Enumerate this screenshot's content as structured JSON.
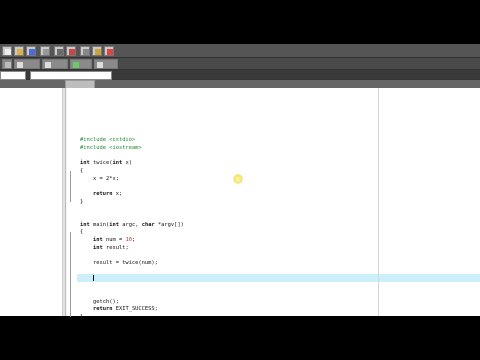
{
  "editor": {
    "lines": [
      {
        "id": "l1",
        "parts": [
          [
            "pp",
            "#include <cstdio>"
          ]
        ]
      },
      {
        "id": "l2",
        "parts": [
          [
            "pp",
            "#include <iostream>"
          ]
        ]
      },
      {
        "id": "l3",
        "parts": []
      },
      {
        "id": "l4",
        "parts": [
          [
            "kw",
            "int"
          ],
          [
            "",
            " twice("
          ],
          [
            "kw",
            "int"
          ],
          [
            "",
            " x)"
          ]
        ]
      },
      {
        "id": "l5",
        "parts": [
          [
            "",
            "{"
          ]
        ]
      },
      {
        "id": "l6",
        "parts": [
          [
            "",
            "    x = 2*x;"
          ]
        ]
      },
      {
        "id": "l7",
        "parts": []
      },
      {
        "id": "l8",
        "parts": [
          [
            "",
            "    "
          ],
          [
            "kw",
            "return"
          ],
          [
            "",
            " x;"
          ]
        ]
      },
      {
        "id": "l9",
        "parts": [
          [
            "",
            "}"
          ]
        ]
      },
      {
        "id": "l10",
        "parts": []
      },
      {
        "id": "l11",
        "parts": []
      },
      {
        "id": "l12",
        "parts": [
          [
            "kw",
            "int"
          ],
          [
            "",
            " main("
          ],
          [
            "kw",
            "int"
          ],
          [
            "",
            " argc, "
          ],
          [
            "kw",
            "char"
          ],
          [
            "",
            " *argv[])"
          ]
        ]
      },
      {
        "id": "l13",
        "parts": [
          [
            "",
            "{"
          ]
        ]
      },
      {
        "id": "l14",
        "parts": [
          [
            "",
            "    "
          ],
          [
            "kw",
            "int"
          ],
          [
            "",
            " num = "
          ],
          [
            "num",
            "10"
          ],
          [
            "",
            ";"
          ]
        ]
      },
      {
        "id": "l15",
        "parts": [
          [
            "",
            "    "
          ],
          [
            "kw",
            "int"
          ],
          [
            "",
            " result;"
          ]
        ]
      },
      {
        "id": "l16",
        "parts": []
      },
      {
        "id": "l17",
        "parts": [
          [
            "",
            "    result = twice(num);"
          ]
        ]
      },
      {
        "id": "l18",
        "parts": []
      },
      {
        "id": "l19",
        "parts": [
          [
            "",
            "    "
          ]
        ],
        "caret": true,
        "highlight": true
      },
      {
        "id": "l20",
        "parts": []
      },
      {
        "id": "l21",
        "parts": []
      },
      {
        "id": "l22",
        "parts": [
          [
            "",
            "    getch();"
          ]
        ]
      },
      {
        "id": "l23",
        "parts": [
          [
            "",
            "    "
          ],
          [
            "kw",
            "return"
          ],
          [
            "",
            " EXIT_SUCCESS;"
          ]
        ]
      },
      {
        "id": "l24",
        "parts": [
          [
            "",
            "}"
          ]
        ]
      }
    ]
  },
  "colors": {
    "preprocessor": "#1c8a2e",
    "current_line": "#cdeffb",
    "toolbar": "#555555"
  }
}
